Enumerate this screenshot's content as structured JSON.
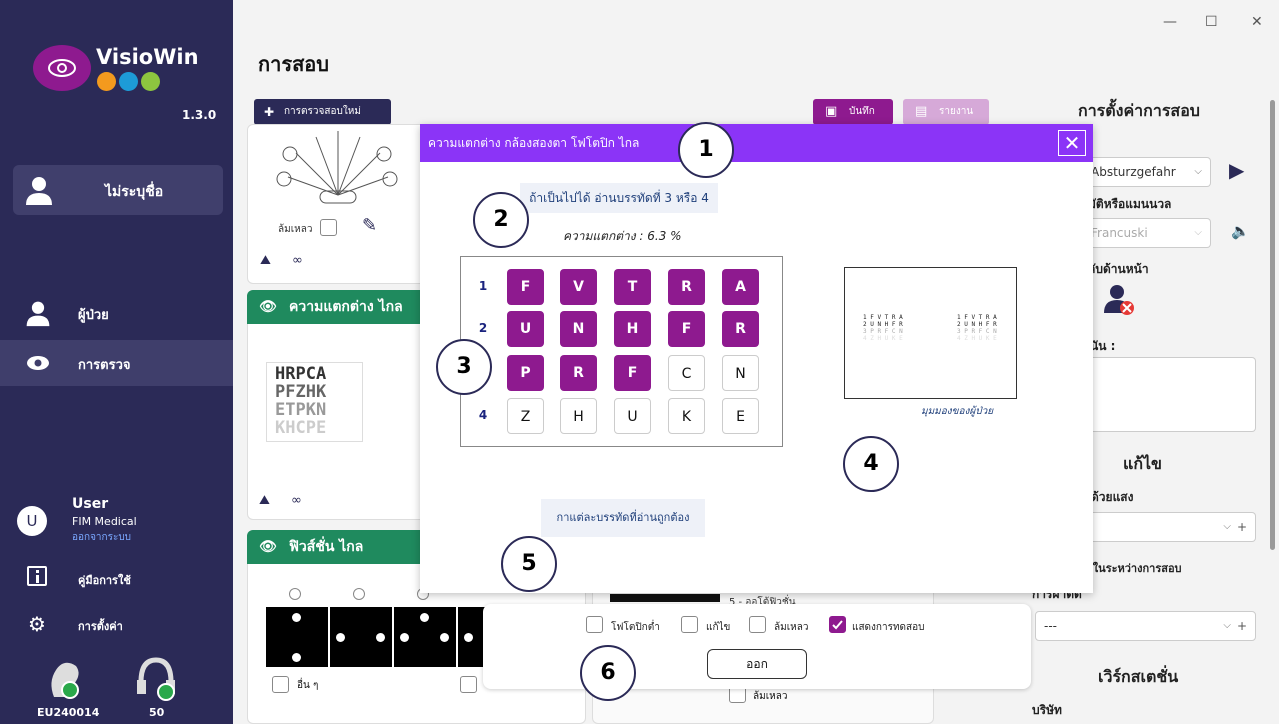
{
  "app": {
    "name": "VisioWin",
    "version": "1.3.0"
  },
  "sidebar": {
    "patient": "ไม่ระบุชื่อ",
    "nav": [
      {
        "label": "ผู้ป่วย"
      },
      {
        "label": "การตรวจ"
      }
    ],
    "user": {
      "initial": "U",
      "name": "User",
      "org": "FIM Medical",
      "logout": "ออกจากระบบ"
    },
    "manual": "คู่มือการใช้",
    "settings": "การตั้งค่า",
    "devices": [
      {
        "label": "EU240014"
      },
      {
        "label": "50"
      }
    ]
  },
  "page": {
    "title": "การสอบ"
  },
  "toolbar": {
    "new_exam": "การตรวจสอบใหม่",
    "save": "บันทึก",
    "report": "รายงาน"
  },
  "left": {
    "fall_label": "ล้มเหลว",
    "group1_title": "ความแตกต่าง ไกล",
    "chart_rows": [
      "HRPCA",
      "PFZHK",
      "ETPKN",
      "KHCPE"
    ],
    "group2_title": "ฟิวส์ชั่น ไกล",
    "others_label": "อื่น ๆ"
  },
  "center_behind": {
    "item5": "5 - ออโต้ฟิวชั่น",
    "fail": "ล้มเหลว"
  },
  "right_panel": {
    "title": "การตั้งค่าการสอบ",
    "select1": "Absturzgefahr",
    "label_auto": "มัติหรือแมนนวล",
    "select2": "Francuski",
    "label_front": "ลับด้านหน้า",
    "label_note": "นัน :",
    "correction_title": "แก้ไข",
    "label_light": "ด้วยแสง",
    "label_correction_during": "แก้ไขในระหว่างการสอบ",
    "label_surgery": "การผ่าตัด",
    "select_surgery": "---",
    "workstation_title": "เวิร์กสเตชั่น",
    "label_company": "บริษัท"
  },
  "modal": {
    "title": "ความแตกต่าง กล้องสองตา โฟโตปิก ไกล",
    "instruction": "ถ้าเป็นไปได้ อ่านบรรทัดที่ 3 หรือ 4",
    "contrast": "ความแตกต่าง : 6.3 %",
    "rows": [
      {
        "num": "1",
        "letters": [
          "F",
          "V",
          "T",
          "R",
          "A"
        ],
        "selected": [
          true,
          true,
          true,
          true,
          true
        ]
      },
      {
        "num": "2",
        "letters": [
          "U",
          "N",
          "H",
          "F",
          "R"
        ],
        "selected": [
          true,
          true,
          true,
          true,
          true
        ]
      },
      {
        "num": "3",
        "letters": [
          "P",
          "R",
          "F",
          "C",
          "N"
        ],
        "selected": [
          true,
          true,
          true,
          false,
          false
        ]
      },
      {
        "num": "4",
        "letters": [
          "Z",
          "H",
          "U",
          "K",
          "E"
        ],
        "selected": [
          false,
          false,
          false,
          false,
          false
        ]
      }
    ],
    "preview_caption": "มุมมองของผู้ป่วย",
    "mark_hint": "กาแต่ละบรรทัดที่อ่านถูกต้อง"
  },
  "options": [
    {
      "label": "โฟโตปิกต่ำ",
      "checked": false
    },
    {
      "label": "แก้ไข",
      "checked": false
    },
    {
      "label": "ล้มเหลว",
      "checked": false
    },
    {
      "label": "แสดงการทดสอบ",
      "checked": true
    }
  ],
  "close_label": "ออก",
  "badges": [
    "1",
    "2",
    "3",
    "4",
    "5",
    "6"
  ],
  "colors": {
    "primary": "#8e1a8f",
    "header": "#8b34f7",
    "sidebar": "#2b2a57",
    "green": "#1f8a5e"
  }
}
